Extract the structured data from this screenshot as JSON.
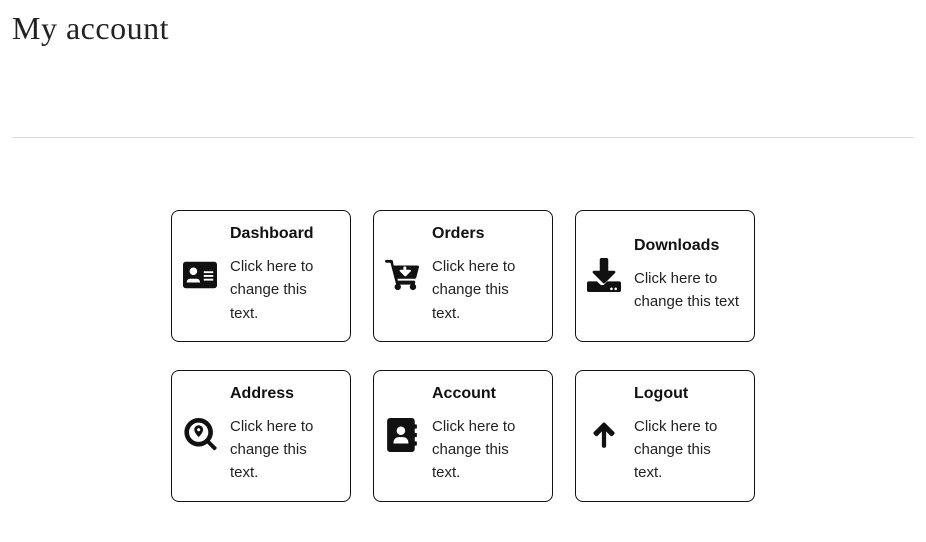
{
  "page": {
    "title": "My account"
  },
  "cards": {
    "dashboard": {
      "title": "Dashboard",
      "text": "Click here to change this text."
    },
    "orders": {
      "title": "Orders",
      "text": "Click here to change this text."
    },
    "downloads": {
      "title": "Downloads",
      "text": "Click here to change this text"
    },
    "address": {
      "title": "Address",
      "text": "Click here to change this text."
    },
    "account": {
      "title": "Account",
      "text": "Click here to change this text."
    },
    "logout": {
      "title": "Logout",
      "text": "Click here to change this text."
    }
  }
}
